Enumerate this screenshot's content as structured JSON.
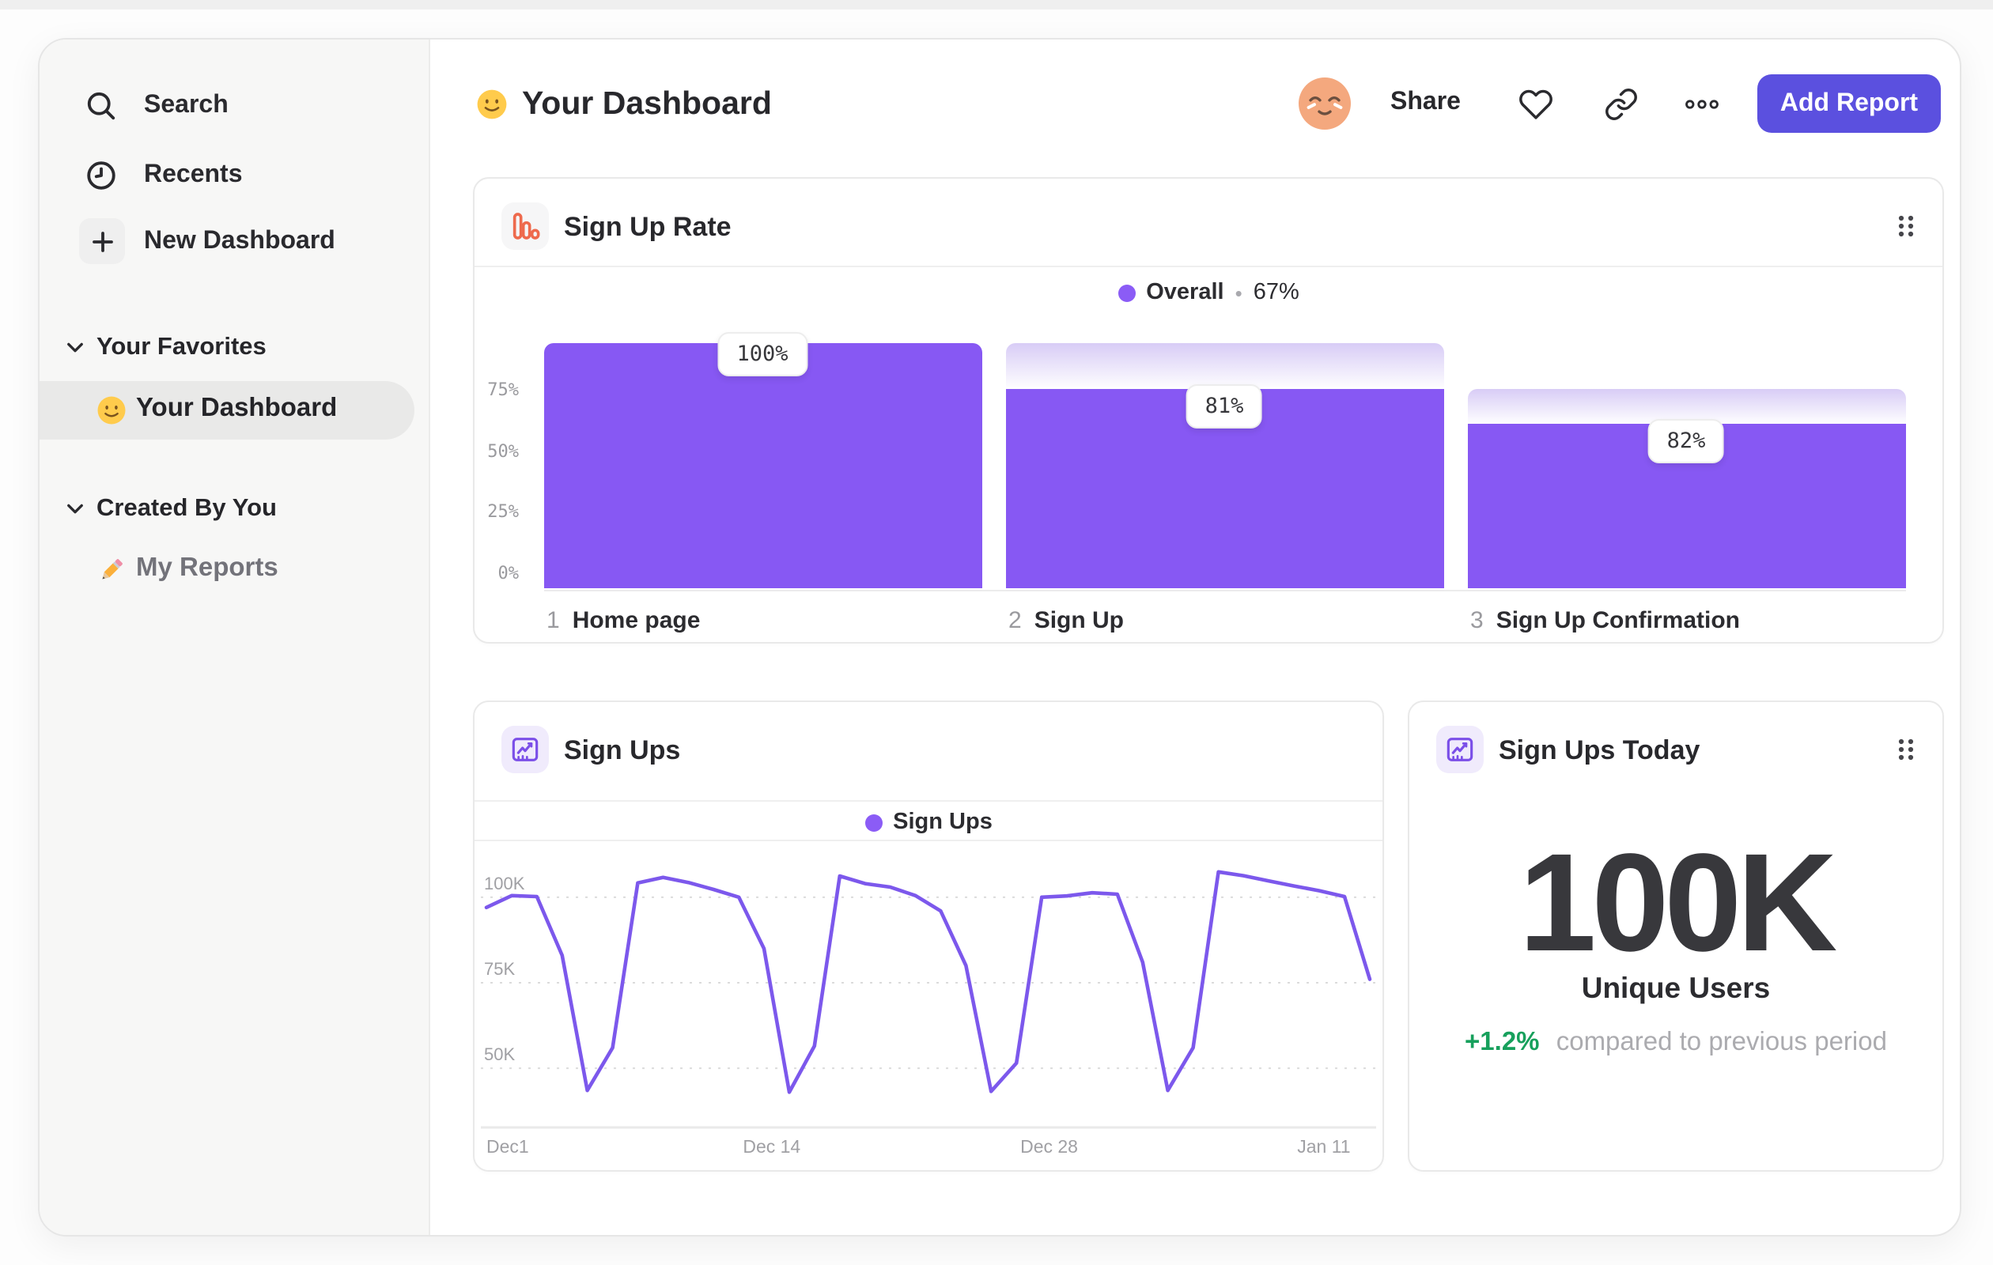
{
  "header": {
    "title": "Your Dashboard",
    "title_emoji_icon": "slightly-smiling-face-emoji",
    "avatar_icon": "relieved-face-avatar",
    "share_label": "Share",
    "add_report_label": "Add Report"
  },
  "sidebar": {
    "items": [
      {
        "label": "Search",
        "icon": "search-icon"
      },
      {
        "label": "Recents",
        "icon": "clock-icon"
      },
      {
        "label": "New Dashboard",
        "icon": "plus-icon"
      }
    ],
    "sections": [
      {
        "label": "Your Favorites",
        "icon": "chevron-down-icon",
        "items": [
          {
            "label": "Your Dashboard",
            "icon": "smiley-emoji",
            "selected": true
          }
        ]
      },
      {
        "label": "Created By You",
        "icon": "chevron-down-icon",
        "items": [
          {
            "label": "My Reports",
            "icon": "pencil-emoji",
            "selected": false
          }
        ]
      }
    ]
  },
  "funnel_card": {
    "title": "Sign Up Rate",
    "icon": "funnel-bars-icon",
    "legend": {
      "series": "Overall",
      "separator": "•",
      "value": "67%"
    }
  },
  "line_card": {
    "title": "Sign Ups",
    "icon": "line-chart-icon",
    "legend": {
      "series": "Sign Ups"
    }
  },
  "metric_card": {
    "title": "Sign Ups Today",
    "icon": "line-chart-icon",
    "value": "100K",
    "label": "Unique Users",
    "delta": "+1.2%",
    "delta_note": "compared to previous period"
  },
  "colors": {
    "bar_purple": "#8758F3",
    "line_purple": "#7C58EC",
    "legend_dot_purple": "#8B5CF6",
    "button_purple": "#5B50DF",
    "icon_orange": "#EE6A4D",
    "icon_purple": "#7B4FE8",
    "delta_green": "#17A05C",
    "gradient_lavender_top": "#D8CCF6",
    "sidebar_bg": "#F7F7F6",
    "selected_pill_bg": "#E9E9E8"
  },
  "chart_data": [
    {
      "type": "bar",
      "subtype": "funnel",
      "title": "Sign Up Rate",
      "legend": "Overall • 67%",
      "legend_position": "top-center",
      "unit": "%",
      "step_numbers": [
        "1",
        "2",
        "3"
      ],
      "categories": [
        "Home page",
        "Sign Up",
        "Sign Up Confirmation"
      ],
      "values_pct_of_first": [
        100,
        81,
        67
      ],
      "step_conversion_labels": [
        "100%",
        "81%",
        "82%"
      ],
      "y_ticks": [
        "75%",
        "50%",
        "25%",
        "0%"
      ],
      "y_tick_values": [
        75,
        50,
        25,
        0
      ],
      "ylim": [
        0,
        100
      ],
      "grid": false
    },
    {
      "type": "line",
      "title": "Sign Ups",
      "series_name": "Sign Ups",
      "legend_position": "top-center",
      "unit": "thousands of sign ups",
      "x_ticks": [
        "Dec1",
        "Dec 14",
        "Dec 28",
        "Jan 11"
      ],
      "x_tick_fracs": [
        0,
        0.323,
        0.637,
        0.948
      ],
      "y_ticks": [
        "100K",
        "75K",
        "50K"
      ],
      "y_tick_values_k": [
        100,
        75,
        50
      ],
      "ylim_k": [
        38,
        112
      ],
      "grid": "dotted-horizontal",
      "values_k": [
        97,
        100.5,
        100.2,
        83,
        43.5,
        56,
        104.2,
        105.8,
        104.3,
        102.3,
        100,
        85,
        43,
        56.5,
        106.2,
        104,
        103,
        100.5,
        96,
        80,
        43.2,
        51.5,
        100,
        100.4,
        101.3,
        100.9,
        81,
        43.5,
        56,
        107.4,
        106.3,
        104.8,
        103.3,
        101.9,
        100.2,
        76
      ]
    }
  ]
}
